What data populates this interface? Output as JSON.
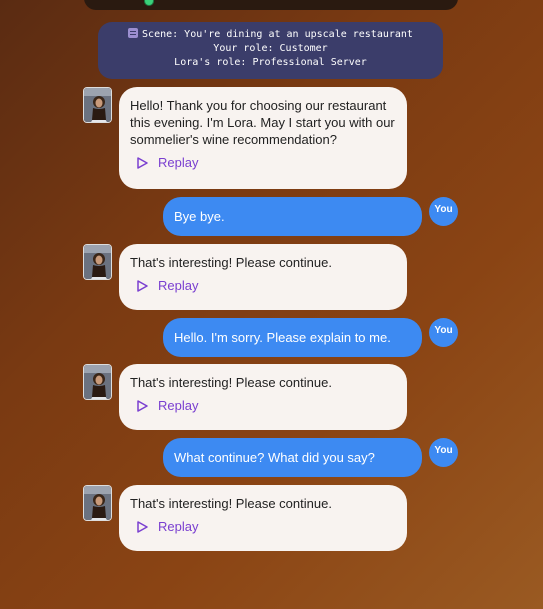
{
  "scene": {
    "line1": "Scene: You're dining at an upscale restaurant",
    "line2": "Your role: Customer",
    "line3": "Lora's role: Professional Server"
  },
  "messages": [
    {
      "role": "ai",
      "text": "Hello! Thank you for choosing our restaurant this evening. I'm Lora. May I start you with our sommelier's wine recommendation?",
      "action": "Replay"
    },
    {
      "role": "user",
      "text": "Bye bye.",
      "badge": "You"
    },
    {
      "role": "ai",
      "text": "That's interesting! Please continue.",
      "action": "Replay"
    },
    {
      "role": "user",
      "text": "Hello. I'm sorry. Please explain to me.",
      "badge": "You"
    },
    {
      "role": "ai",
      "text": "That's interesting! Please continue.",
      "action": "Replay"
    },
    {
      "role": "user",
      "text": "What continue? What did you say?",
      "badge": "You"
    },
    {
      "role": "ai",
      "text": "That's interesting! Please continue.",
      "action": "Replay"
    }
  ],
  "icons": {
    "play": "play-icon",
    "scene": "clapperboard-icon"
  },
  "colors": {
    "user_bubble": "#3d8af2",
    "ai_bubble": "#f8f3f0",
    "replay": "#7a3fd0",
    "scene_box": "#3b3d6a"
  }
}
